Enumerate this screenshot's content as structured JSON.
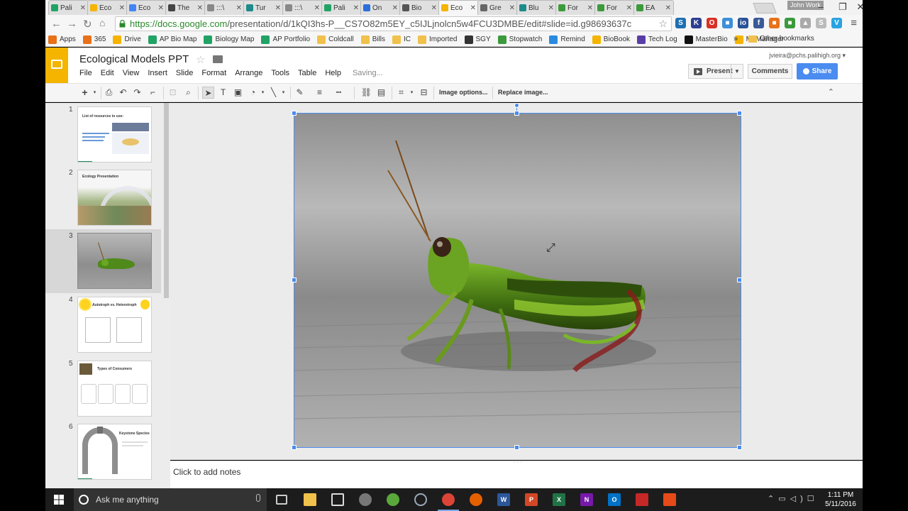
{
  "browser": {
    "profile_name": "John Work",
    "tabs": [
      {
        "label": "Pali",
        "color": "#21a366"
      },
      {
        "label": "Eco",
        "color": "#f4b400"
      },
      {
        "label": "Eco",
        "color": "#4285f4"
      },
      {
        "label": "The",
        "color": "#444444"
      },
      {
        "label": ":::\\",
        "color": "#888888"
      },
      {
        "label": "Tur",
        "color": "#1e8a8a"
      },
      {
        "label": ":::\\",
        "color": "#888888"
      },
      {
        "label": "Pali",
        "color": "#21a366"
      },
      {
        "label": "On",
        "color": "#2a6fdb"
      },
      {
        "label": "Bio",
        "color": "#555555"
      },
      {
        "label": "Eco",
        "color": "#f4b400",
        "active": true
      },
      {
        "label": "Gre",
        "color": "#666666"
      },
      {
        "label": "Blu",
        "color": "#1e8a8a"
      },
      {
        "label": "For",
        "color": "#3c9a3c"
      },
      {
        "label": "For",
        "color": "#3c9a3c"
      },
      {
        "label": "EA",
        "color": "#3c9a3c"
      }
    ],
    "url_host": "https://docs.google.com",
    "url_path": "/presentation/d/1kQI3hs-P__CS7O82m5EY_c5IJLjnolcn5w4FCU3DMBE/edit#slide=id.g98693637c",
    "extensions": [
      {
        "label": "S",
        "color": "#1f6fb2"
      },
      {
        "label": "K",
        "color": "#2c3e8f"
      },
      {
        "label": "O",
        "color": "#d93025"
      },
      {
        "label": "■",
        "color": "#3c8fd8"
      },
      {
        "label": "io",
        "color": "#2a5298"
      },
      {
        "label": "f",
        "color": "#3b5998"
      },
      {
        "label": "■",
        "color": "#e8711a"
      },
      {
        "label": "■",
        "color": "#3c9a3c"
      },
      {
        "label": "▲",
        "color": "#aaaaaa"
      },
      {
        "label": "S",
        "color": "#bbbbbb"
      },
      {
        "label": "V",
        "color": "#2aa3e0"
      }
    ]
  },
  "bookmarks": {
    "items": [
      {
        "label": "Apps",
        "color": "#e8711a"
      },
      {
        "label": "365",
        "color": "#e8711a"
      },
      {
        "label": "Drive",
        "color": "#f4b400"
      },
      {
        "label": "AP Bio Map",
        "color": "#21a366"
      },
      {
        "label": "Biology Map",
        "color": "#21a366"
      },
      {
        "label": "AP Portfolio",
        "color": "#21a366"
      },
      {
        "label": "Coldcall",
        "color": "#f0c14b"
      },
      {
        "label": "Bills",
        "color": "#f0c14b"
      },
      {
        "label": "IC",
        "color": "#f0c14b"
      },
      {
        "label": "Imported",
        "color": "#f0c14b"
      },
      {
        "label": "SGY",
        "color": "#333333"
      },
      {
        "label": "Stopwatch",
        "color": "#3c9a3c"
      },
      {
        "label": "Remind",
        "color": "#2a8ae0"
      },
      {
        "label": "BioBook",
        "color": "#f4b400"
      },
      {
        "label": "Tech Log",
        "color": "#5a3ea8"
      },
      {
        "label": "MasterBio",
        "color": "#111111"
      },
      {
        "label": "M. Manager",
        "color": "#f4b400"
      }
    ],
    "more": "»",
    "other": "Other bookmarks"
  },
  "app": {
    "doc_title": "Ecological Models PPT",
    "menus": [
      "File",
      "Edit",
      "View",
      "Insert",
      "Slide",
      "Format",
      "Arrange",
      "Tools",
      "Table",
      "Help"
    ],
    "status": "Saving...",
    "account": "jvieira@pchs.palihigh.org ▾",
    "present_label": "Present",
    "comments_label": "Comments",
    "share_label": "Share",
    "image_options_label": "Image options...",
    "replace_image_label": "Replace image..."
  },
  "slides": [
    {
      "num": "1",
      "title": "List of resources to use:"
    },
    {
      "num": "2",
      "title": "Ecology Presentation"
    },
    {
      "num": "3",
      "title": ""
    },
    {
      "num": "4",
      "title": "Autotroph vs. Heterotroph"
    },
    {
      "num": "5",
      "title": "Types of Consumers"
    },
    {
      "num": "6",
      "title": "Keystone Species"
    }
  ],
  "notes": {
    "placeholder": "Click to add notes"
  },
  "taskbar": {
    "search_placeholder": "Ask me anything",
    "time": "1:11 PM",
    "date": "5/11/2016"
  }
}
